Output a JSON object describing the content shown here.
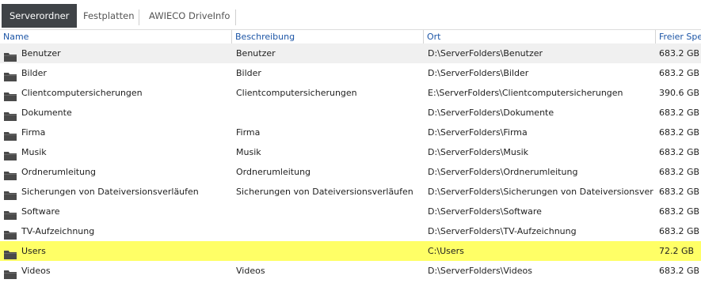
{
  "tabs": [
    {
      "label": "Serverordner",
      "active": true
    },
    {
      "label": "Festplatten",
      "active": false
    },
    {
      "label": "AWIECO DriveInfo",
      "active": false
    }
  ],
  "columns": {
    "name": "Name",
    "description": "Beschreibung",
    "location": "Ort",
    "free_space": "Freier Spei"
  },
  "rows": [
    {
      "name": "Benutzer",
      "description": "Benutzer",
      "location": "D:\\ServerFolders\\Benutzer",
      "free": "683.2 GB"
    },
    {
      "name": "Bilder",
      "description": "Bilder",
      "location": "D:\\ServerFolders\\Bilder",
      "free": "683.2 GB"
    },
    {
      "name": "Clientcomputersicherungen",
      "description": "Clientcomputersicherungen",
      "location": "E:\\ServerFolders\\Clientcomputersicherungen",
      "free": "390.6 GB"
    },
    {
      "name": "Dokumente",
      "description": "",
      "location": "D:\\ServerFolders\\Dokumente",
      "free": "683.2 GB"
    },
    {
      "name": "Firma",
      "description": "Firma",
      "location": "D:\\ServerFolders\\Firma",
      "free": "683.2 GB"
    },
    {
      "name": "Musik",
      "description": "Musik",
      "location": "D:\\ServerFolders\\Musik",
      "free": "683.2 GB"
    },
    {
      "name": "Ordnerumleitung",
      "description": "Ordnerumleitung",
      "location": "D:\\ServerFolders\\Ordnerumleitung",
      "free": "683.2 GB"
    },
    {
      "name": "Sicherungen von Dateiversionsverläufen",
      "description": "Sicherungen von Dateiversionsverläufen",
      "location": "D:\\ServerFolders\\Sicherungen von Dateiversionsverlä...",
      "free": "683.2 GB"
    },
    {
      "name": "Software",
      "description": "",
      "location": "D:\\ServerFolders\\Software",
      "free": "683.2 GB"
    },
    {
      "name": "TV-Aufzeichnung",
      "description": "",
      "location": "D:\\ServerFolders\\TV-Aufzeichnung",
      "free": "683.2 GB"
    },
    {
      "name": "Users",
      "description": "",
      "location": "C:\\Users",
      "free": "72.2 GB"
    },
    {
      "name": "Videos",
      "description": "Videos",
      "location": "D:\\ServerFolders\\Videos",
      "free": "683.2 GB"
    }
  ],
  "colors": {
    "active_tab_bg": "#3f4347",
    "header_text": "#1c55a6",
    "highlight_row": "#ffff66",
    "alt_row": "#f0f0f0",
    "folder_icon": "#4a4a4a"
  },
  "icons": {
    "row_icon": "folder-icon"
  }
}
